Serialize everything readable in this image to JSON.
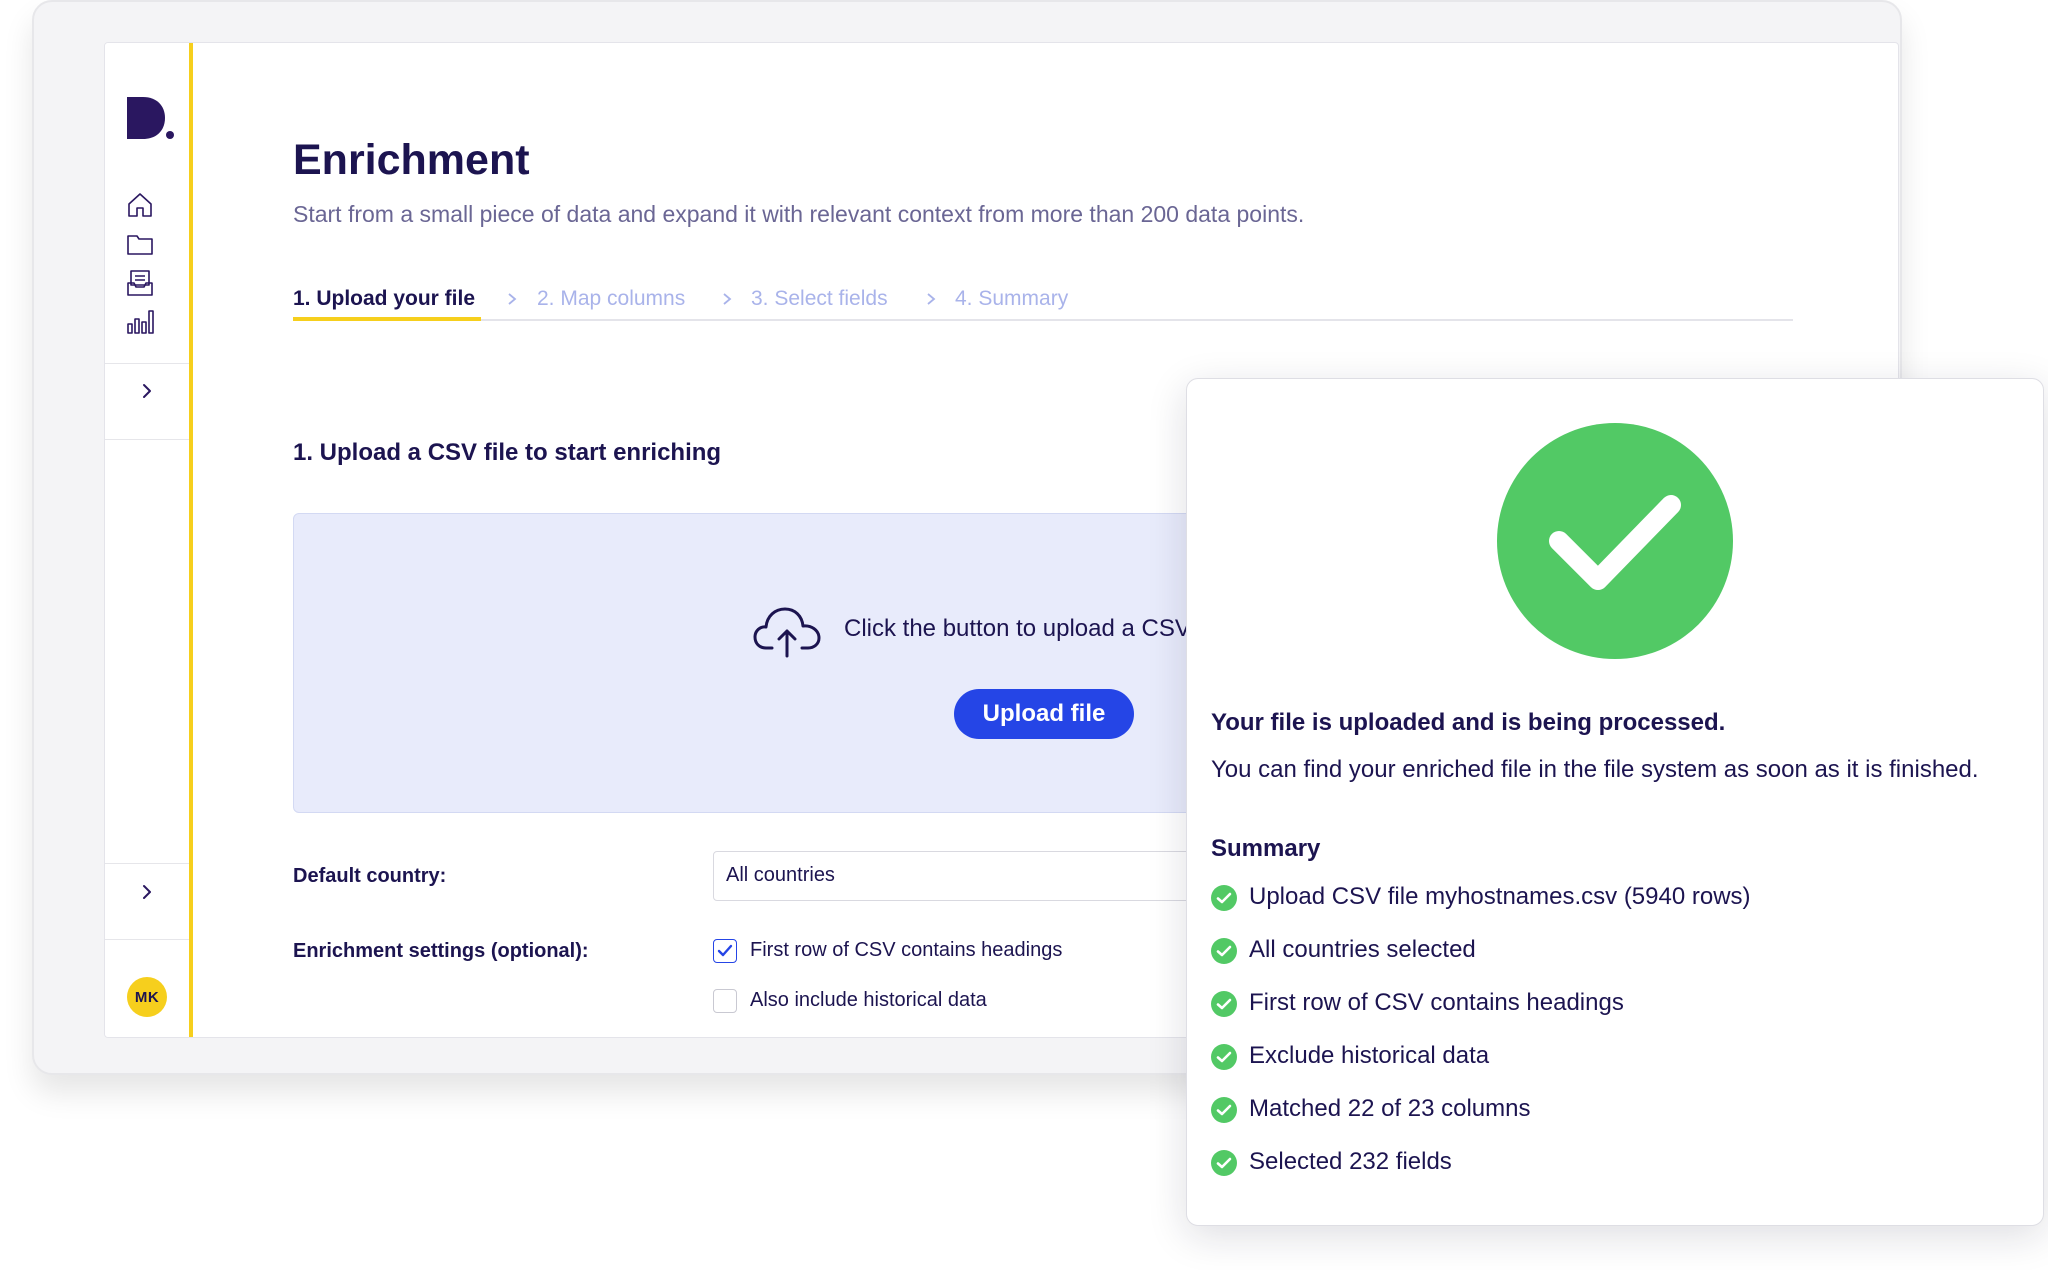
{
  "app": {
    "nav_icons": [
      "home-icon",
      "folder-icon",
      "inbox-icon",
      "bar-chart-icon"
    ],
    "avatar_initials": "MK"
  },
  "page": {
    "title": "Enrichment",
    "subtitle": "Start from a small piece of data and expand it with relevant context from more than 200 data points."
  },
  "steps": [
    {
      "label": "1. Upload your file",
      "active": true
    },
    {
      "label": "2. Map columns",
      "active": false
    },
    {
      "label": "3. Select fields",
      "active": false
    },
    {
      "label": "4. Summary",
      "active": false
    }
  ],
  "upload": {
    "section_title": "1. Upload a CSV file to start enriching",
    "prompt": "Click the button to upload a CSV",
    "button_label": "Upload file"
  },
  "form": {
    "country_label": "Default country:",
    "country_value": "All countries",
    "settings_label": "Enrichment settings (optional):",
    "options": [
      {
        "label": "First row of CSV contains headings",
        "checked": true
      },
      {
        "label": "Also include historical data",
        "checked": false
      }
    ]
  },
  "modal": {
    "headline": "Your file is uploaded and is being processed.",
    "message": "You can find your enriched file in the file system as soon as it is finished.",
    "summary_title": "Summary",
    "summary_items": [
      "Upload CSV file myhostnames.csv (5940 rows)",
      "All countries selected",
      "First row of CSV contains headings",
      "Exclude historical data",
      "Matched 22 of 23 columns",
      "Selected 232 fields"
    ]
  },
  "colors": {
    "brand_navy": "#1c1450",
    "accent_yellow": "#f6cf1d",
    "primary_blue": "#2545e6",
    "success_green": "#52c965",
    "dropzone_bg": "#e8ebfb",
    "inactive_step": "#a9b3ea"
  }
}
